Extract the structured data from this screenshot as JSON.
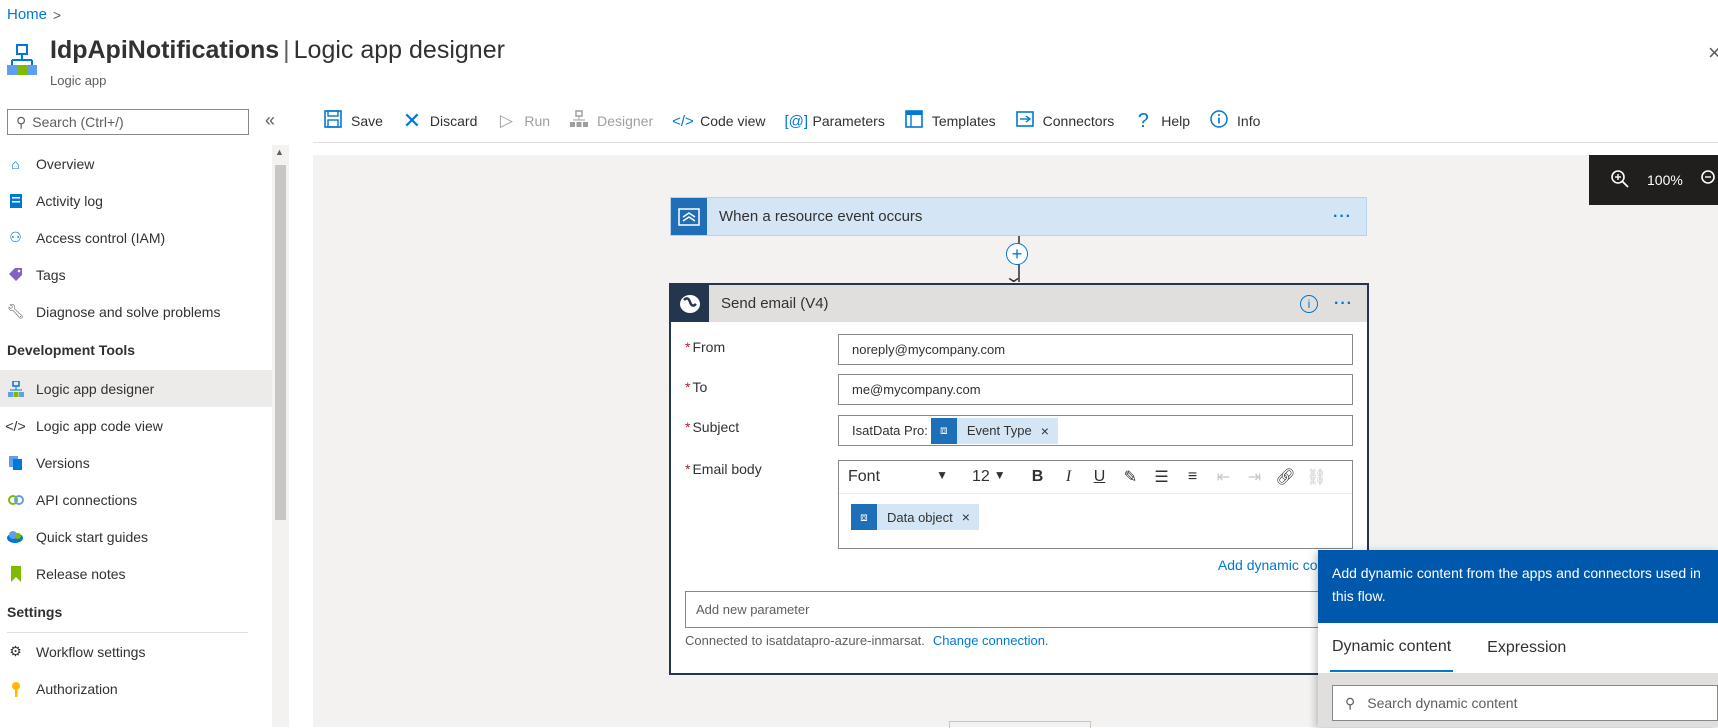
{
  "breadcrumb": {
    "home": "Home",
    "separator": ">"
  },
  "header": {
    "app_name": "IdpApiNotifications",
    "separator": "|",
    "page_title": "Logic app designer",
    "subtitle": "Logic app",
    "close": "×"
  },
  "sidebar": {
    "search_placeholder": "Search (Ctrl+/)",
    "collapse": "«",
    "items": [
      {
        "label": "Overview",
        "icon": "overview-icon"
      },
      {
        "label": "Activity log",
        "icon": "activity-log-icon"
      },
      {
        "label": "Access control (IAM)",
        "icon": "people-icon"
      },
      {
        "label": "Tags",
        "icon": "tag-icon"
      },
      {
        "label": "Diagnose and solve problems",
        "icon": "wrench-icon"
      }
    ],
    "section_dev": "Development Tools",
    "dev_items": [
      {
        "label": "Logic app designer",
        "icon": "designer-icon",
        "active": true
      },
      {
        "label": "Logic app code view",
        "icon": "code-icon"
      },
      {
        "label": "Versions",
        "icon": "versions-icon"
      },
      {
        "label": "API connections",
        "icon": "api-connection-icon"
      },
      {
        "label": "Quick start guides",
        "icon": "cloud-icon"
      },
      {
        "label": "Release notes",
        "icon": "bookmark-icon"
      }
    ],
    "section_settings": "Settings",
    "settings_items": [
      {
        "label": "Workflow settings",
        "icon": "gear-icon"
      },
      {
        "label": "Authorization",
        "icon": "key-icon"
      }
    ]
  },
  "toolbar": {
    "save": "Save",
    "discard": "Discard",
    "run": "Run",
    "designer": "Designer",
    "code_view": "Code view",
    "parameters": "Parameters",
    "templates": "Templates",
    "connectors": "Connectors",
    "help": "Help",
    "info": "Info"
  },
  "zoom": {
    "level": "100%"
  },
  "trigger": {
    "title": "When a resource event occurs",
    "more": "···"
  },
  "action": {
    "title": "Send email (V4)",
    "more": "···",
    "from_label": "From",
    "from_value": "noreply@mycompany.com",
    "to_label": "To",
    "to_value": "me@mycompany.com",
    "subject_label": "Subject",
    "subject_prefix": "IsatData Pro:",
    "subject_token": "Event Type",
    "body_label": "Email body",
    "font": "Font",
    "font_size": "12",
    "body_token": "Data object",
    "add_dynamic": "Add dynamic conte",
    "add_param_placeholder": "Add new parameter",
    "connected_text": "Connected to isatdatapro-azure-inmarsat.",
    "change_connection": "Change connection."
  },
  "dynamic_panel": {
    "header": "Add dynamic content from the apps and connectors used in this flow.",
    "tab_dynamic": "Dynamic content",
    "tab_expression": "Expression",
    "search_placeholder": "Search dynamic content"
  },
  "colors": {
    "accent": "#0078d4",
    "action_header": "#24354e",
    "panel_header": "#0058ad",
    "trigger_bg": "#d4e6f5"
  }
}
